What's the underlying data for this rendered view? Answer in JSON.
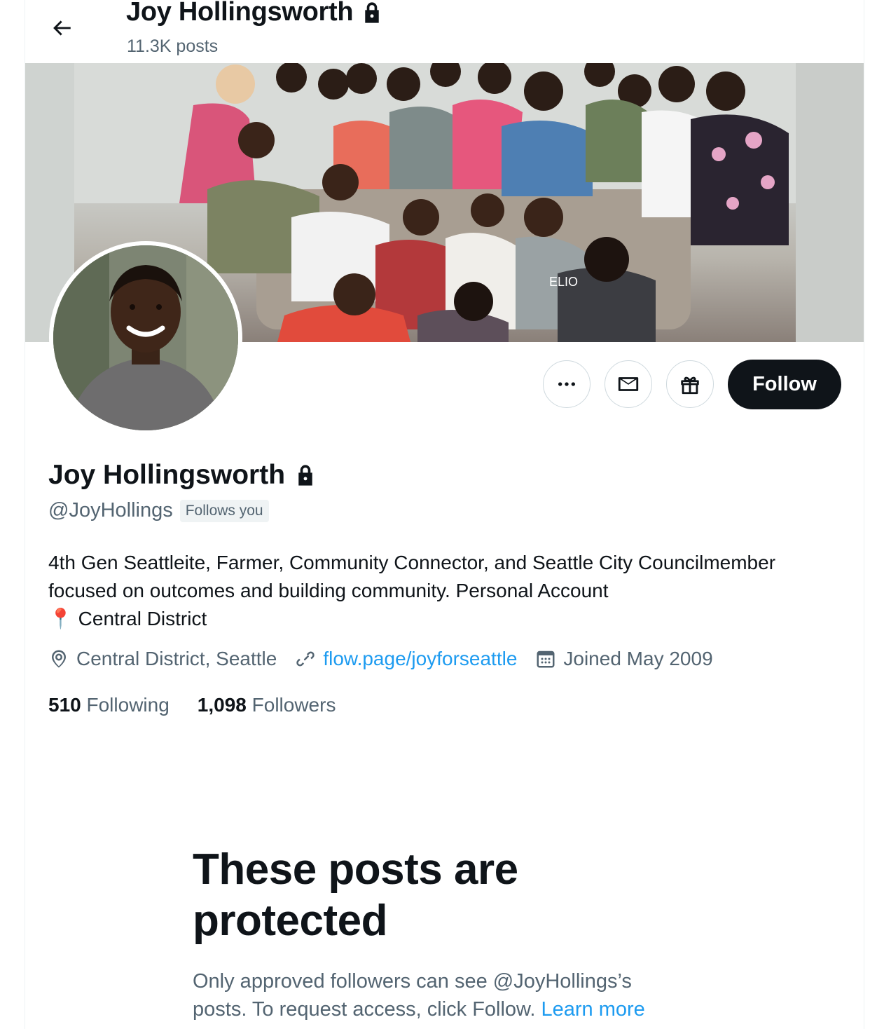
{
  "header": {
    "title": "Joy Hollingsworth",
    "posts_count": "11.3K posts"
  },
  "banner": {
    "shirt_text": "ELIO"
  },
  "actions": {
    "follow_label": "Follow"
  },
  "profile": {
    "name": "Joy Hollingsworth",
    "handle": "@JoyHollings",
    "follows_you": "Follows you",
    "bio_line1": "4th Gen Seattleite, Farmer, Community Connector, and Seattle City Councilmember focused on outcomes and building community.  Personal Account",
    "bio_pin": "📍",
    "bio_line2": "Central District",
    "location": "Central District, Seattle",
    "website": "flow.page/joyforseattle",
    "joined": "Joined May 2009",
    "following_count": "510",
    "following_label": "Following",
    "followers_count": "1,098",
    "followers_label": "Followers"
  },
  "protected": {
    "heading": "These posts are protected",
    "body": "Only approved followers can see @JoyHollings’s posts. To request access, click Follow.",
    "learn_more": "Learn more"
  },
  "icons": [
    "back-arrow-icon",
    "lock-icon",
    "more-icon",
    "mail-icon",
    "gift-icon",
    "location-icon",
    "link-icon",
    "calendar-icon"
  ],
  "colors": {
    "text": "#0f1419",
    "secondary": "#536471",
    "link": "#1d9bf0",
    "follow_bg": "#0f1419"
  }
}
